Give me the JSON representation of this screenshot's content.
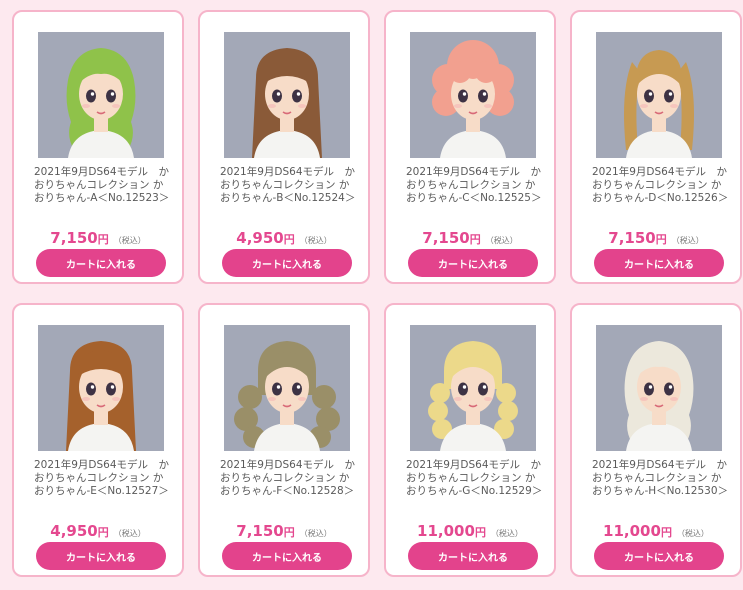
{
  "theme": {
    "accent": "#e3438c",
    "price_color": "#e4488f",
    "card_border": "#f6b4ca",
    "background": "#fde9ef"
  },
  "products": [
    {
      "title": "2021年9月DS64モデル　かおりちゃんコレクション かおりちゃん-A＜No.12523＞",
      "price": "7,150",
      "currency": "円",
      "tax_note": "（税込）",
      "cart_label": "カートに入れる",
      "hair_color": "#8fc24a",
      "hair_style": "wavy-long"
    },
    {
      "title": "2021年9月DS64モデル　かおりちゃんコレクション かおりちゃん-B＜No.12524＞",
      "price": "4,950",
      "currency": "円",
      "tax_note": "（税込）",
      "cart_label": "カートに入れる",
      "hair_color": "#8a5a38",
      "hair_style": "straight-long"
    },
    {
      "title": "2021年9月DS64モデル　かおりちゃんコレクション かおりちゃん-C＜No.12525＞",
      "price": "7,150",
      "currency": "円",
      "tax_note": "（税込）",
      "cart_label": "カートに入れる",
      "hair_color": "#f2a08f",
      "hair_style": "curly-short"
    },
    {
      "title": "2021年9月DS64モデル　かおりちゃんコレクション かおりちゃん-D＜No.12526＞",
      "price": "7,150",
      "currency": "円",
      "tax_note": "（税込）",
      "cart_label": "カートに入れる",
      "hair_color": "#c79a52",
      "hair_style": "pigtails"
    },
    {
      "title": "2021年9月DS64モデル　かおりちゃんコレクション かおりちゃん-E＜No.12527＞",
      "price": "4,950",
      "currency": "円",
      "tax_note": "（税込）",
      "cart_label": "カートに入れる",
      "hair_color": "#a5612c",
      "hair_style": "straight-long"
    },
    {
      "title": "2021年9月DS64モデル　かおりちゃんコレクション かおりちゃん-F＜No.12528＞",
      "price": "7,150",
      "currency": "円",
      "tax_note": "（税込）",
      "cart_label": "カートに入れる",
      "hair_color": "#9a8f68",
      "hair_style": "curly-long"
    },
    {
      "title": "2021年9月DS64モデル　かおりちゃんコレクション かおりちゃん-G＜No.12529＞",
      "price": "11,000",
      "currency": "円",
      "tax_note": "（税込）",
      "cart_label": "カートに入れる",
      "hair_color": "#ecd98a",
      "hair_style": "ringlets"
    },
    {
      "title": "2021年9月DS64モデル　かおりちゃんコレクション かおりちゃん-H＜No.12530＞",
      "price": "11,000",
      "currency": "円",
      "tax_note": "（税込）",
      "cart_label": "カートに入れる",
      "hair_color": "#ece8dc",
      "hair_style": "wavy-long"
    }
  ]
}
